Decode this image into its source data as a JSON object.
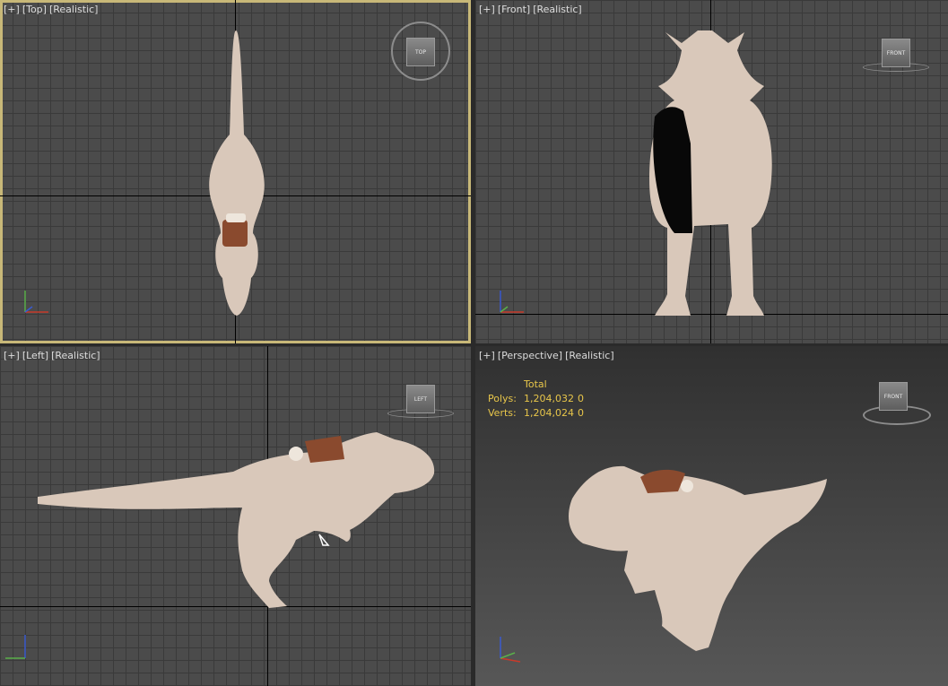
{
  "viewports": {
    "top": {
      "plus": "[+]",
      "view": "[Top]",
      "shade": "[Realistic]",
      "cube": "TOP"
    },
    "front": {
      "plus": "[+]",
      "view": "[Front]",
      "shade": "[Realistic]",
      "cube": "FRONT"
    },
    "left": {
      "plus": "[+]",
      "view": "[Left]",
      "shade": "[Realistic]",
      "cube": "LEFT"
    },
    "perspective": {
      "plus": "[+]",
      "view": "[Perspective]",
      "shade": "[Realistic]",
      "cube": "FRONT"
    }
  },
  "stats": {
    "header": "Total",
    "polys_label": "Polys:",
    "polys_value": "1,204,032",
    "polys_sel": "0",
    "verts_label": "Verts:",
    "verts_value": "1,204,024",
    "verts_sel": "0"
  },
  "colors": {
    "active_border": "#c8b878",
    "model": "#d9c8ba",
    "saddle": "#8a4a2e",
    "stats_text": "#e8c64a"
  },
  "icons": [
    "viewcube-icon",
    "axis-gizmo-icon"
  ]
}
